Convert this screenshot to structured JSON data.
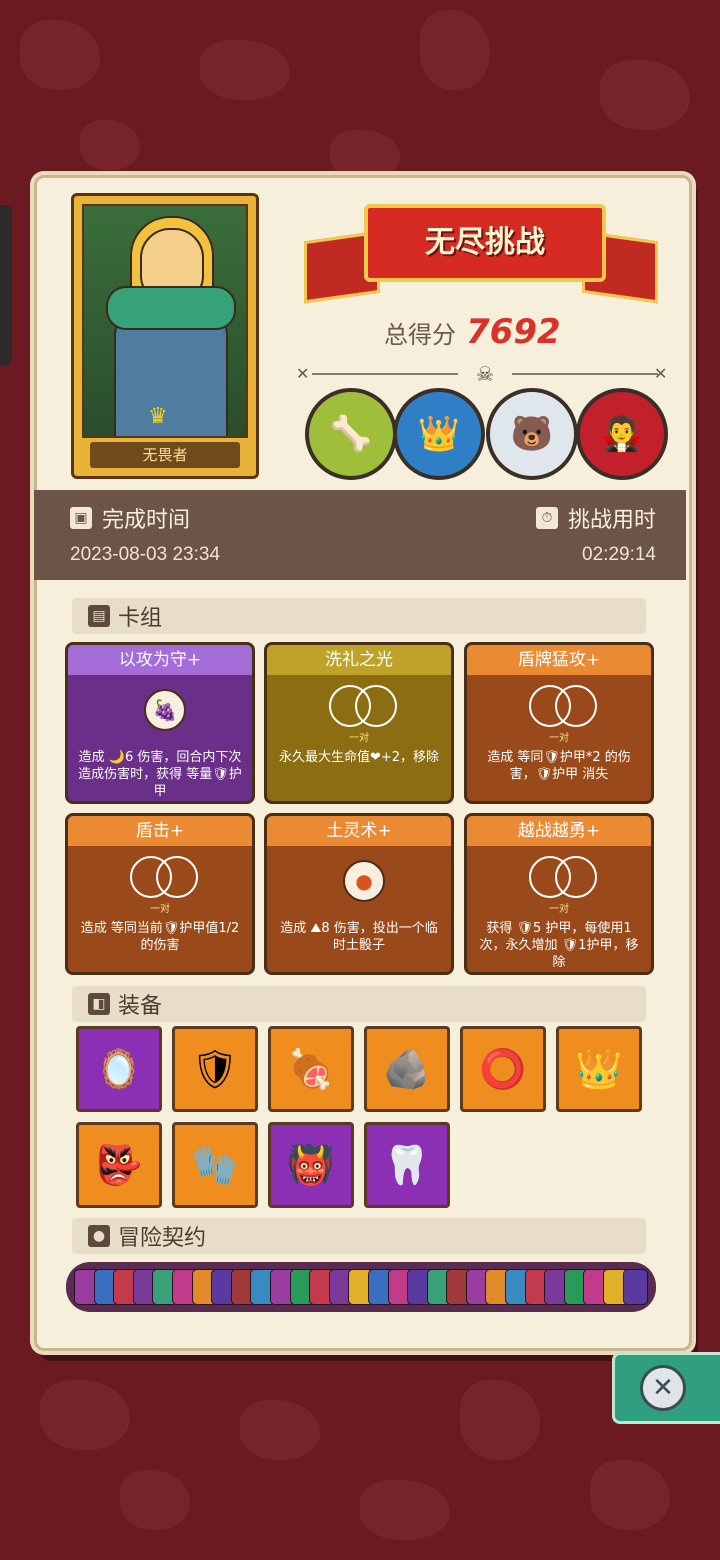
{
  "hero": {
    "name": "无畏者"
  },
  "banner": {
    "title": "无尽挑战"
  },
  "score": {
    "label": "总得分",
    "value": "7692"
  },
  "bosses": [
    "boss-skeleton-dino",
    "boss-blue-queen",
    "boss-white-yeti",
    "boss-vampire"
  ],
  "times": {
    "finish_label": "完成时间",
    "finish_value": "2023-08-03  23:34",
    "duration_label": "挑战用时",
    "duration_value": "02:29:14"
  },
  "sections": {
    "deck": "卡组",
    "equipment": "装备",
    "contract": "冒险契约"
  },
  "cards": [
    {
      "title": "以攻为守+",
      "sub": "",
      "desc": "造成 🌙6 伤害，回合内下次造成伤害时，获得 等量🛡护甲"
    },
    {
      "title": "洗礼之光",
      "sub": "一对",
      "desc": "永久最大生命值❤+2，移除"
    },
    {
      "title": "盾牌猛攻+",
      "sub": "一对",
      "desc": "造成 等同🛡护甲*2 的伤害，🛡护甲 消失"
    },
    {
      "title": "盾击+",
      "sub": "一对",
      "desc": "造成 等同当前🛡护甲值1/2的伤害"
    },
    {
      "title": "土灵术+",
      "sub": "",
      "desc": "造成 ⛰8 伤害，投出一个临时土骰子"
    },
    {
      "title": "越战越勇+",
      "sub": "一对",
      "desc": "获得 🛡5 护甲，每使用1次，永久增加 🛡1护甲，移除"
    }
  ],
  "equipment": [
    "mirror-icon",
    "shield-gem-icon",
    "meat-icon",
    "moss-stone-icon",
    "ring-icon",
    "crown-icon",
    "tribal-mask-icon",
    "claw-glove-icon",
    "demon-badge-icon",
    "fangs-icon"
  ],
  "colors": {
    "accent_red": "#d8322a",
    "panel": "#f6efdb",
    "band": "#6c5446"
  }
}
